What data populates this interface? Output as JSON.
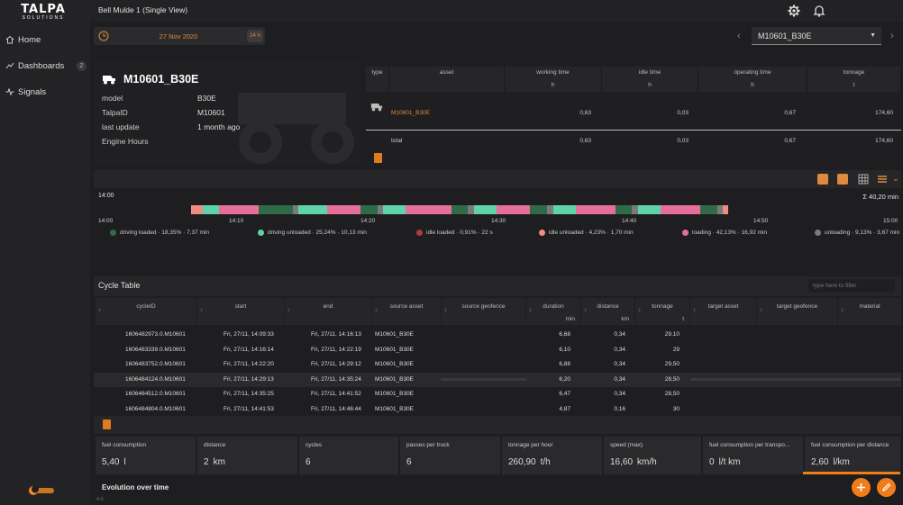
{
  "brand": {
    "name": "TALPA",
    "sub": "SOLUTIONS"
  },
  "header": {
    "title": "Bell Mulde 1 (Single View)",
    "icons": [
      "gear-icon",
      "bell-icon"
    ]
  },
  "sidebar": {
    "items": [
      {
        "label": "Home",
        "icon": "home-icon"
      },
      {
        "label": "Dashboards",
        "icon": "chart-icon",
        "badge": "2"
      },
      {
        "label": "Signals",
        "icon": "pulse-icon"
      }
    ]
  },
  "datebar": {
    "date": "27 Nov 2020",
    "range": "24 h"
  },
  "asset_select": {
    "value": "M10601_B30E"
  },
  "asset": {
    "title": "M10601_B30E",
    "fields": [
      {
        "key": "model",
        "value": "B30E"
      },
      {
        "key": "TalpaID",
        "value": "M10601"
      },
      {
        "key": "last update",
        "value": "1 month ago"
      },
      {
        "key": "Engine Hours",
        "value": ""
      }
    ]
  },
  "summary": {
    "columns": [
      {
        "name": "type",
        "unit": ""
      },
      {
        "name": "asset",
        "unit": ""
      },
      {
        "name": "working time",
        "unit": "h"
      },
      {
        "name": "idle time",
        "unit": "h"
      },
      {
        "name": "operating time",
        "unit": "h"
      },
      {
        "name": "tonnage",
        "unit": "t"
      }
    ],
    "row": {
      "asset": "M10601_B30E",
      "working": "0,63",
      "idle": "0,03",
      "operating": "0,67",
      "tonnage": "174,60"
    },
    "total": {
      "label": "total",
      "working": "0,63",
      "idle": "0,03",
      "operating": "0,67",
      "tonnage": "174,60"
    }
  },
  "timeline": {
    "start_label": "14:00",
    "sum_label": "Σ 40,20 min",
    "ticks": [
      "14:00",
      "14:10",
      "14:20",
      "14:30",
      "14:40",
      "14:50",
      "15:00"
    ],
    "colors": {
      "driving_loaded": "#2f6b46",
      "driving_unloaded": "#5fd3a8",
      "idle_loaded": "#b33a3a",
      "idle_unloaded": "#f08b84",
      "loading": "#e56e9a",
      "unloading": "#7a7a7a"
    },
    "segments": [
      {
        "state": "idle_unloaded",
        "weight": 2
      },
      {
        "state": "driving_unloaded",
        "weight": 3
      },
      {
        "state": "loading",
        "weight": 7
      },
      {
        "state": "driving_loaded",
        "weight": 6
      },
      {
        "state": "unloading",
        "weight": 1
      },
      {
        "state": "driving_unloaded",
        "weight": 5
      },
      {
        "state": "loading",
        "weight": 6
      },
      {
        "state": "driving_loaded",
        "weight": 3
      },
      {
        "state": "unloading",
        "weight": 1
      },
      {
        "state": "driving_unloaded",
        "weight": 4
      },
      {
        "state": "loading",
        "weight": 8
      },
      {
        "state": "driving_loaded",
        "weight": 3
      },
      {
        "state": "unloading",
        "weight": 1
      },
      {
        "state": "driving_unloaded",
        "weight": 4
      },
      {
        "state": "loading",
        "weight": 6
      },
      {
        "state": "driving_loaded",
        "weight": 3
      },
      {
        "state": "unloading",
        "weight": 1
      },
      {
        "state": "driving_unloaded",
        "weight": 4
      },
      {
        "state": "loading",
        "weight": 7
      },
      {
        "state": "driving_loaded",
        "weight": 3
      },
      {
        "state": "unloading",
        "weight": 1
      },
      {
        "state": "driving_unloaded",
        "weight": 4
      },
      {
        "state": "loading",
        "weight": 7
      },
      {
        "state": "driving_loaded",
        "weight": 3
      },
      {
        "state": "unloading",
        "weight": 1
      },
      {
        "state": "idle_unloaded",
        "weight": 1
      }
    ],
    "legend": [
      {
        "state": "driving_loaded",
        "label": "driving loaded · 18,35% · 7,37 min"
      },
      {
        "state": "driving_unloaded",
        "label": "driving unloaded · 25,24% · 10,13 min"
      },
      {
        "state": "idle_loaded",
        "label": "idle loaded · 0,91% · 22 s"
      },
      {
        "state": "idle_unloaded",
        "label": "idle unloaded · 4,23% · 1,70 min"
      },
      {
        "state": "loading",
        "label": "loading · 42,13% · 16,92 min"
      },
      {
        "state": "unloading",
        "label": "unloading · 9,13% · 3,67 min"
      }
    ]
  },
  "cycle_table": {
    "title": "Cycle Table",
    "filter_placeholder": "type here to filter",
    "columns": [
      {
        "name": "cycleID",
        "unit": ""
      },
      {
        "name": "start",
        "unit": ""
      },
      {
        "name": "end",
        "unit": ""
      },
      {
        "name": "source asset",
        "unit": ""
      },
      {
        "name": "source geofence",
        "unit": ""
      },
      {
        "name": "duration",
        "unit": "min"
      },
      {
        "name": "distance",
        "unit": "km"
      },
      {
        "name": "tonnage",
        "unit": "t"
      },
      {
        "name": "target asset",
        "unit": ""
      },
      {
        "name": "target geofence",
        "unit": ""
      },
      {
        "name": "material",
        "unit": ""
      }
    ],
    "rows": [
      {
        "id": "1606482973.0.M10601",
        "start": "Fri, 27/11, 14:09:33",
        "end": "Fri, 27/11, 14:16:13",
        "source": "M10601_B30E",
        "duration": "6,68",
        "distance": "0,34",
        "tonnage": "29,10"
      },
      {
        "id": "1606483339.0.M10601",
        "start": "Fri, 27/11, 14:16:14",
        "end": "Fri, 27/11, 14:22:19",
        "source": "M10601_B30E",
        "duration": "6,10",
        "distance": "0,34",
        "tonnage": "29"
      },
      {
        "id": "1606483752.0.M10601",
        "start": "Fri, 27/11, 14:22:20",
        "end": "Fri, 27/11, 14:29:12",
        "source": "M10601_B30E",
        "duration": "6,88",
        "distance": "0,34",
        "tonnage": "29,50"
      },
      {
        "id": "1606484124.0.M10601",
        "start": "Fri, 27/11, 14:29:13",
        "end": "Fri, 27/11, 14:35:24",
        "source": "M10601_B30E",
        "duration": "6,20",
        "distance": "0,34",
        "tonnage": "28,50"
      },
      {
        "id": "1606484512.0.M10601",
        "start": "Fri, 27/11, 14:35:25",
        "end": "Fri, 27/11, 14:41:52",
        "source": "M10601_B30E",
        "duration": "6,47",
        "distance": "0,34",
        "tonnage": "28,50"
      },
      {
        "id": "1606484804.0.M10601",
        "start": "Fri, 27/11, 14:41:53",
        "end": "Fri, 27/11, 14:46:44",
        "source": "M10601_B30E",
        "duration": "4,87",
        "distance": "0,16",
        "tonnage": "30"
      }
    ]
  },
  "kpis": [
    {
      "title": "fuel consumption",
      "value": "5,40",
      "unit": "l"
    },
    {
      "title": "distance",
      "value": "2",
      "unit": "km"
    },
    {
      "title": "cycles",
      "value": "6",
      "unit": ""
    },
    {
      "title": "passes per truck",
      "value": "6",
      "unit": ""
    },
    {
      "title": "tonnage per hour",
      "value": "260,90",
      "unit": "t/h"
    },
    {
      "title": "speed (max)",
      "value": "16,60",
      "unit": "km/h"
    },
    {
      "title": "fuel consumption per transpo...",
      "value": "0",
      "unit": "l/t km"
    },
    {
      "title": "fuel consumption per distance",
      "value": "2,60",
      "unit": "l/km"
    }
  ],
  "evolution": {
    "title": "Evolution over time"
  },
  "version": "4.0",
  "accent": "#f07d1a"
}
